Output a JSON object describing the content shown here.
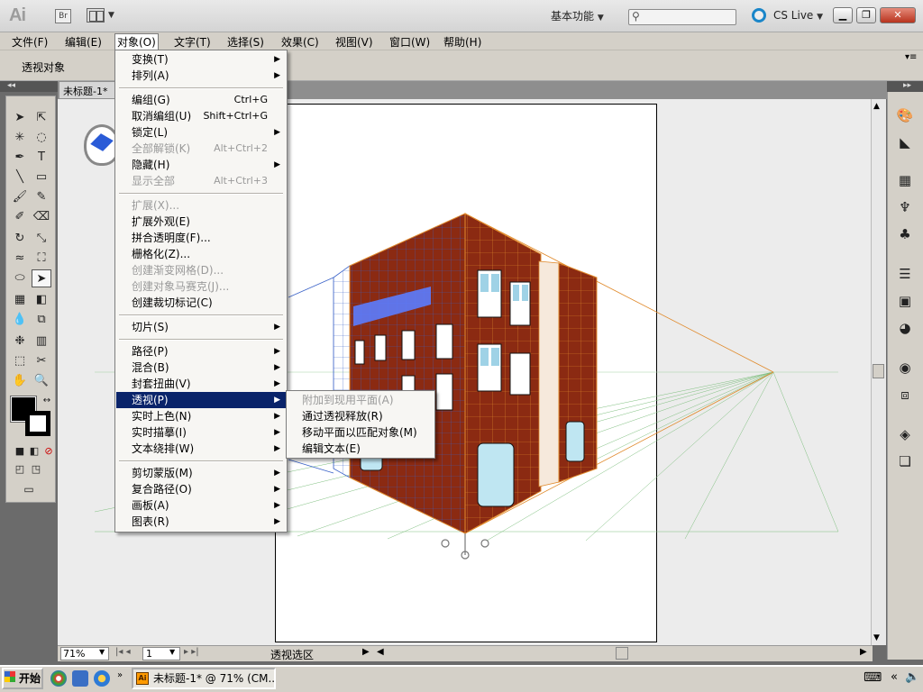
{
  "app": {
    "logo": "Ai",
    "bridge": "Br",
    "workspace": "基本功能",
    "cs_live": "CS Live"
  },
  "menubar": [
    "文件(F)",
    "编辑(E)",
    "对象(O)",
    "文字(T)",
    "选择(S)",
    "效果(C)",
    "视图(V)",
    "窗口(W)",
    "帮助(H)"
  ],
  "control_bar": {
    "label": "透视对象"
  },
  "document_tab": {
    "title": "未标题-1*"
  },
  "object_menu": [
    {
      "label": "变换(T)",
      "submenu": true
    },
    {
      "label": "排列(A)",
      "submenu": true
    },
    {
      "sep": true
    },
    {
      "label": "编组(G)",
      "shortcut": "Ctrl+G"
    },
    {
      "label": "取消编组(U)",
      "shortcut": "Shift+Ctrl+G"
    },
    {
      "label": "锁定(L)",
      "submenu": true
    },
    {
      "label": "全部解锁(K)",
      "shortcut": "Alt+Ctrl+2",
      "disabled": true
    },
    {
      "label": "隐藏(H)",
      "submenu": true
    },
    {
      "label": "显示全部",
      "shortcut": "Alt+Ctrl+3",
      "disabled": true
    },
    {
      "sep": true
    },
    {
      "label": "扩展(X)...",
      "disabled": true
    },
    {
      "label": "扩展外观(E)"
    },
    {
      "label": "拼合透明度(F)..."
    },
    {
      "label": "栅格化(Z)..."
    },
    {
      "label": "创建渐变网格(D)...",
      "disabled": true
    },
    {
      "label": "创建对象马赛克(J)...",
      "disabled": true
    },
    {
      "label": "创建裁切标记(C)"
    },
    {
      "sep": true
    },
    {
      "label": "切片(S)",
      "submenu": true
    },
    {
      "sep": true
    },
    {
      "label": "路径(P)",
      "submenu": true
    },
    {
      "label": "混合(B)",
      "submenu": true
    },
    {
      "label": "封套扭曲(V)",
      "submenu": true
    },
    {
      "label": "透视(P)",
      "submenu": true,
      "highlighted": true
    },
    {
      "label": "实时上色(N)",
      "submenu": true
    },
    {
      "label": "实时描摹(I)",
      "submenu": true
    },
    {
      "label": "文本绕排(W)",
      "submenu": true
    },
    {
      "sep": true
    },
    {
      "label": "剪切蒙版(M)",
      "submenu": true
    },
    {
      "label": "复合路径(O)",
      "submenu": true
    },
    {
      "label": "画板(A)",
      "submenu": true
    },
    {
      "label": "图表(R)",
      "submenu": true
    }
  ],
  "perspective_submenu": [
    {
      "label": "附加到现用平面(A)",
      "disabled": true
    },
    {
      "label": "通过透视释放(R)"
    },
    {
      "label": "移动平面以匹配对象(M)"
    },
    {
      "label": "编辑文本(E)"
    }
  ],
  "status": {
    "zoom": "71%",
    "page": "1",
    "text": "透视选区"
  },
  "taskbar": {
    "start": "开始",
    "task": "未标题-1* @ 71% (CM..."
  },
  "colors": {
    "highlight": "#0a246a",
    "brick": "#8b2a12",
    "grid_orange": "#e08a2c",
    "grid_blue": "#3a62c8",
    "grid_green": "#6aa86a"
  }
}
